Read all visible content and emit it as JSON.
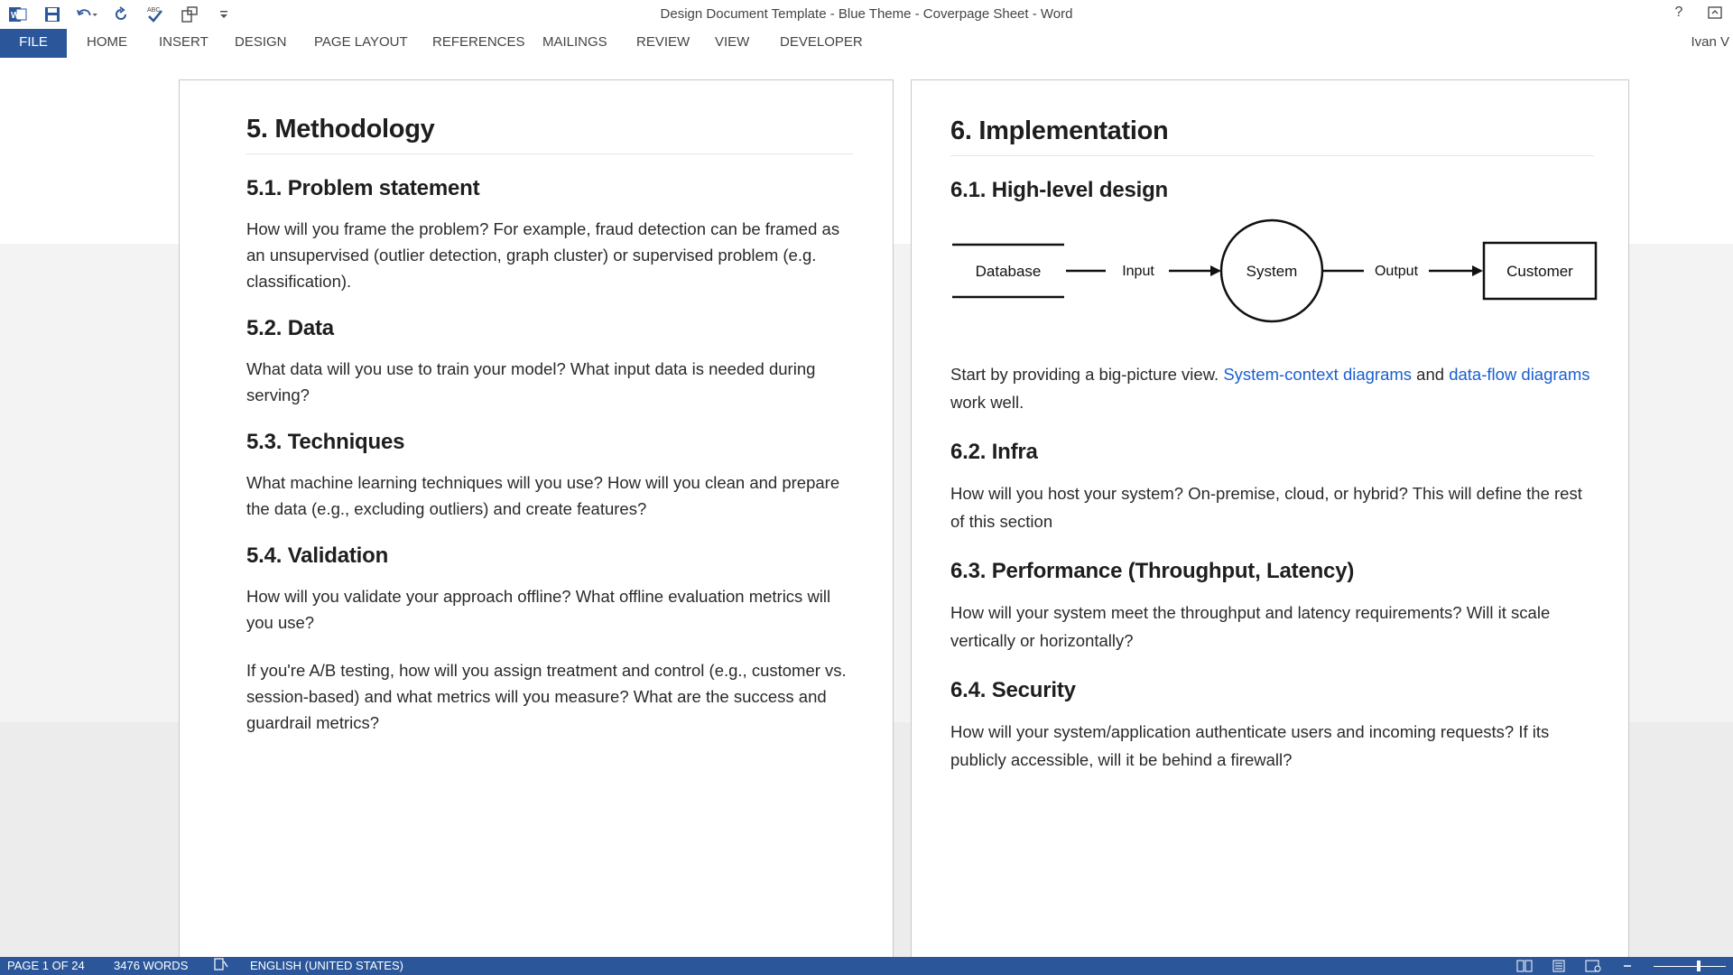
{
  "window": {
    "title": "Design Document Template - Blue Theme - Coverpage Sheet - Word",
    "user": "Ivan V"
  },
  "ribbon": {
    "tabs": [
      "FILE",
      "HOME",
      "INSERT",
      "DESIGN",
      "PAGE LAYOUT",
      "REFERENCES",
      "MAILINGS",
      "REVIEW",
      "VIEW",
      "DEVELOPER"
    ]
  },
  "left_page": {
    "heading": "5. Methodology",
    "sections": [
      {
        "title": "5.1. Problem statement",
        "paragraphs": [
          "How will you frame the problem? For example, fraud detection can be framed as an unsupervised (outlier detection, graph cluster) or supervised problem (e.g. classification)."
        ]
      },
      {
        "title": "5.2. Data",
        "paragraphs": [
          "What data will you use to train your model? What input data is needed during serving?"
        ]
      },
      {
        "title": "5.3. Techniques",
        "paragraphs": [
          "What machine learning techniques will you use? How will you clean and prepare the data (e.g., excluding outliers) and create features?"
        ]
      },
      {
        "title": "5.4. Validation",
        "paragraphs": [
          "How will you validate your approach offline? What offline evaluation metrics will you use?",
          "If you're A/B testing, how will you assign treatment and control (e.g., customer vs. session-based) and what metrics will you measure? What are the success and guardrail metrics?"
        ]
      }
    ]
  },
  "right_page": {
    "heading": "6. Implementation",
    "design_title": "6.1. High-level design",
    "diagram": {
      "database": "Database",
      "input": "Input",
      "system": "System",
      "output": "Output",
      "customer": "Customer"
    },
    "design_text": {
      "before": "Start by providing a big-picture view. ",
      "link1": "System-context diagrams",
      "middle": " and ",
      "link2": "data-flow diagrams",
      "after": " work well."
    },
    "sections": [
      {
        "title": "6.2. Infra",
        "text": "How will you host your system? On-premise, cloud, or hybrid? This will define the rest of this section"
      },
      {
        "title": "6.3. Performance (Throughput, Latency)",
        "text": "How will your system meet the throughput and latency requirements? Will it scale vertically or horizontally?"
      },
      {
        "title": "6.4. Security",
        "text": "How will your system/application authenticate users and incoming requests? If its publicly accessible, will it be behind a firewall?"
      }
    ]
  },
  "statusbar": {
    "page": "PAGE 1 OF 24",
    "words": "3476 WORDS",
    "language": "ENGLISH (UNITED STATES)"
  },
  "colors": {
    "accent": "#2b579a",
    "link": "#1a5fd0"
  }
}
